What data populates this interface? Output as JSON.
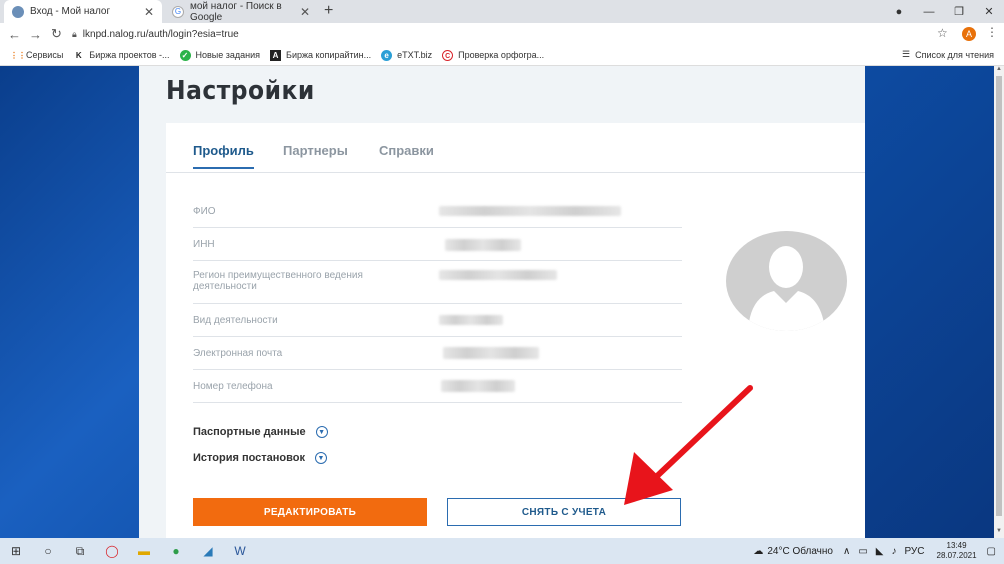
{
  "browser": {
    "tabs": [
      {
        "title": "Вход - Мой налог",
        "active": true
      },
      {
        "title": "мой налог - Поиск в Google",
        "active": false
      }
    ],
    "url": "lknpd.nalog.ru/auth/login?esia=true",
    "profile_initial": "A",
    "bookmarks": [
      "Сервисы",
      "Биржа проектов -...",
      "Новые задания",
      "Биржа копирайтин...",
      "eTXT.biz",
      "Проверка орфогра..."
    ],
    "reading_list": "Список для чтения"
  },
  "page": {
    "title": "Настройки",
    "tabs": [
      {
        "label": "Профиль",
        "active": true
      },
      {
        "label": "Партнеры",
        "active": false
      },
      {
        "label": "Справки",
        "active": false
      }
    ],
    "fields": [
      {
        "label": "ФИО"
      },
      {
        "label": "ИНН"
      },
      {
        "label": "Регион преимущественного ведения деятельности"
      },
      {
        "label": "Вид деятельности"
      },
      {
        "label": "Электронная почта"
      },
      {
        "label": "Номер телефона"
      }
    ],
    "sections": [
      {
        "label": "Паспортные данные"
      },
      {
        "label": "История постановок"
      }
    ],
    "buttons": {
      "edit": "РЕДАКТИРОВАТЬ",
      "deregister": "СНЯТЬ С УЧЕТА"
    }
  },
  "taskbar": {
    "weather": "24°C Облачно",
    "lang": "РУС",
    "time": "13:49",
    "date": "28.07.2021"
  },
  "colors": {
    "accent": "#f26b0f",
    "brand": "#2b6cb0",
    "arrow": "#e8141b"
  }
}
